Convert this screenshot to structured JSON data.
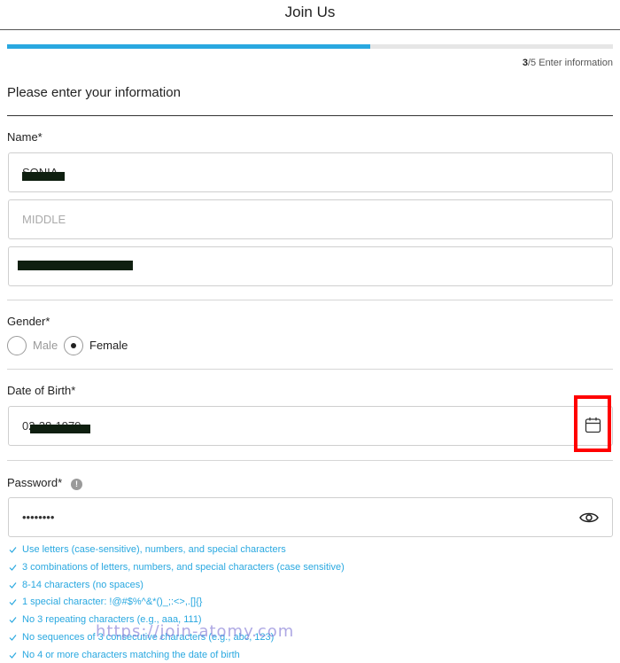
{
  "header": {
    "title": "Join Us"
  },
  "progress": {
    "current": "3",
    "total": "/5",
    "label": " Enter information",
    "fraction": 0.6
  },
  "form": {
    "section_title": "Please enter your information",
    "name": {
      "label": "Name*",
      "first_value": "SONIA",
      "middle_placeholder": "MIDDLE"
    },
    "gender": {
      "label": "Gender*",
      "options": [
        "Male",
        "Female"
      ],
      "selected": "Female"
    },
    "dob": {
      "label": "Date of Birth*",
      "value": "02-28-1979"
    },
    "password": {
      "label": "Password*",
      "value": "••••••••",
      "rules": [
        "Use letters (case-sensitive), numbers, and special characters",
        "3 combinations of letters, numbers, and special characters (case sensitive)",
        "8-14 characters (no spaces)",
        "1 special character: !@#$%^&*()_;:<>,.[]{}",
        "No 3 repeating characters (e.g., aaa, 111)",
        "No sequences of 3 consecutive characters (e.g., abc, 123)",
        "No 4 or more characters matching the date of birth"
      ]
    }
  },
  "colors": {
    "accent": "#29a8e0",
    "highlight": "#ff0000",
    "redaction": "#0f1f10"
  },
  "icons": {
    "calendar": "calendar-icon",
    "eye": "eye-icon",
    "info": "info-icon",
    "check": "check-icon"
  },
  "watermark": "https://join-atomy.com"
}
